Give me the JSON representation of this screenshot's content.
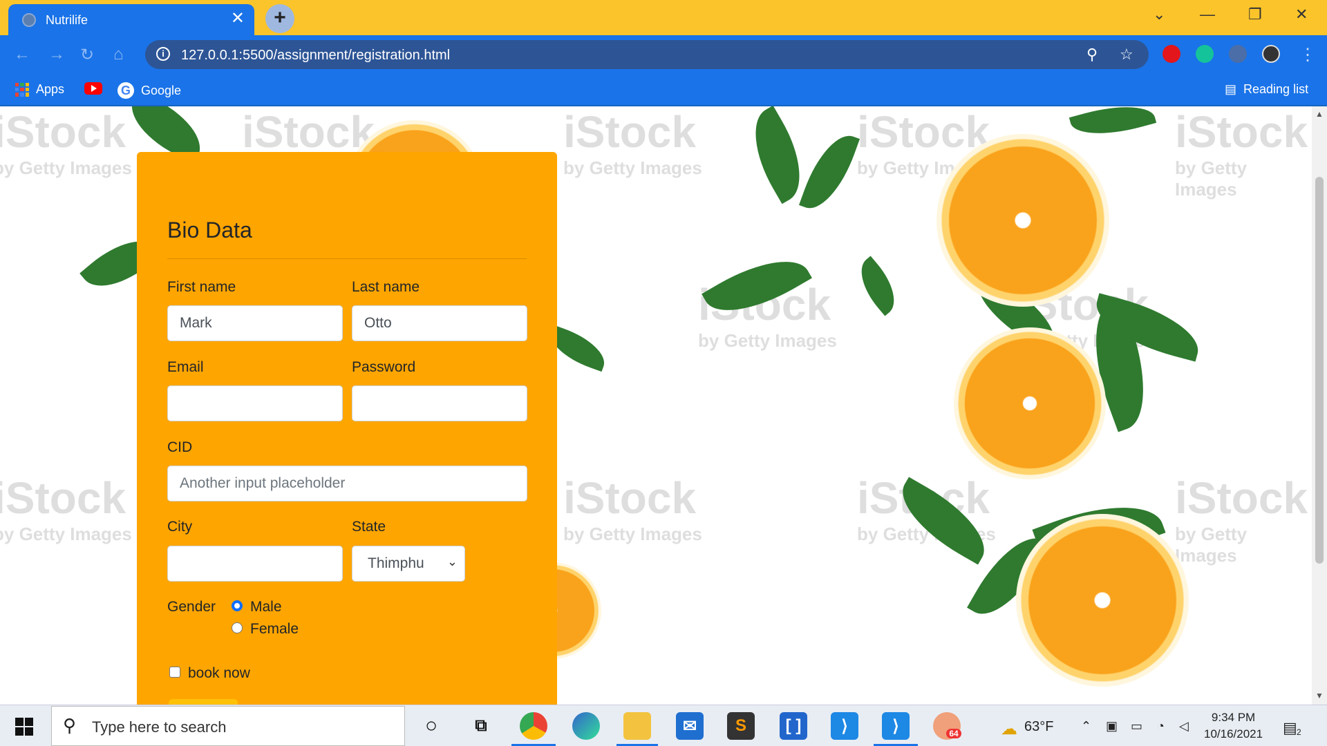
{
  "browser": {
    "tab_title": "Nutrilife",
    "tab_close": "✕",
    "new_tab": "+",
    "window_controls": {
      "list": "⌄",
      "minimize": "—",
      "restore": "❐",
      "close": "✕"
    },
    "url": "127.0.0.1:5500/assignment/registration.html",
    "bookmarks": {
      "apps": "Apps",
      "google": "Google",
      "reading_list": "Reading list"
    }
  },
  "form": {
    "heading": "Bio Data",
    "first_name_label": "First name",
    "first_name_value": "Mark",
    "last_name_label": "Last name",
    "last_name_value": "Otto",
    "email_label": "Email",
    "password_label": "Password",
    "cid_label": "CID",
    "cid_placeholder": "Another input placeholder",
    "city_label": "City",
    "state_label": "State",
    "state_value": "Thimphu",
    "gender_label": "Gender",
    "gender_options": [
      "Male",
      "Female"
    ],
    "gender_selected": "Male",
    "book_now_label": "book now"
  },
  "background": {
    "watermark_text": "iStock",
    "watermark_sub": "by Getty Images"
  },
  "taskbar": {
    "search_placeholder": "Type here to search",
    "weather": "63°F",
    "time": "9:34 PM",
    "date": "10/16/2021",
    "notification_count": "2",
    "telegram_badge": "64"
  },
  "colors": {
    "chrome_tab_bar": "#fbc42a",
    "chrome_toolbar": "#1a73e8",
    "card_background": "#ffa500"
  }
}
